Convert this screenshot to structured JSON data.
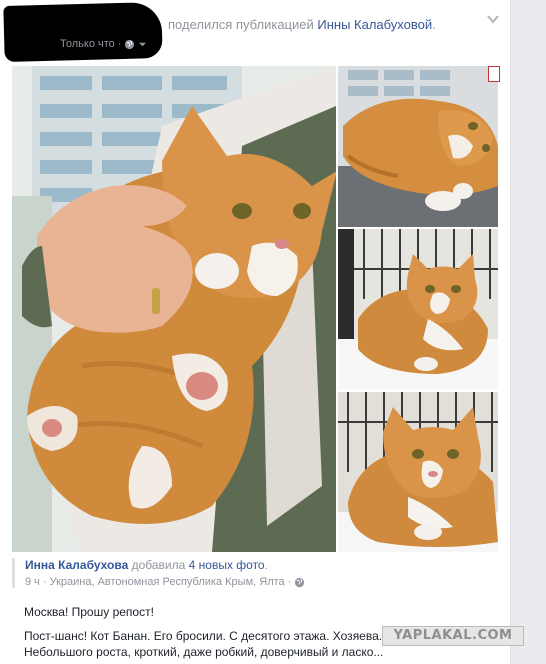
{
  "header": {
    "action_text": "поделился публикацией",
    "target_name": "Инны Калабуховой",
    "period": ".",
    "time": "Только что",
    "separator": "·"
  },
  "attribution": {
    "author": "Инна Калабухова",
    "verb": "добавила",
    "photos_link": "4 новых фото",
    "period": ".",
    "time": "9 ч",
    "separator": "·",
    "location": "Украина, Автономная Республика Крым, Ялта",
    "separator2": "·"
  },
  "post": {
    "line1": "Москва! Прошу репост!",
    "line2": "Пост-шанс! Кот Банан. Его бросили. С десятого этажа. Хозяева. Выше, конечно.",
    "line3": "Небольшого роста, кроткий, даже робкий, доверчивый и ласко..."
  },
  "watermark": "YAPLAKAL.COM",
  "icons": {
    "privacy": "globe-icon",
    "menu": "chevron-down-icon",
    "location_privacy": "globe-icon"
  },
  "colors": {
    "link": "#365899",
    "muted": "#90949c",
    "text": "#1d2129"
  }
}
